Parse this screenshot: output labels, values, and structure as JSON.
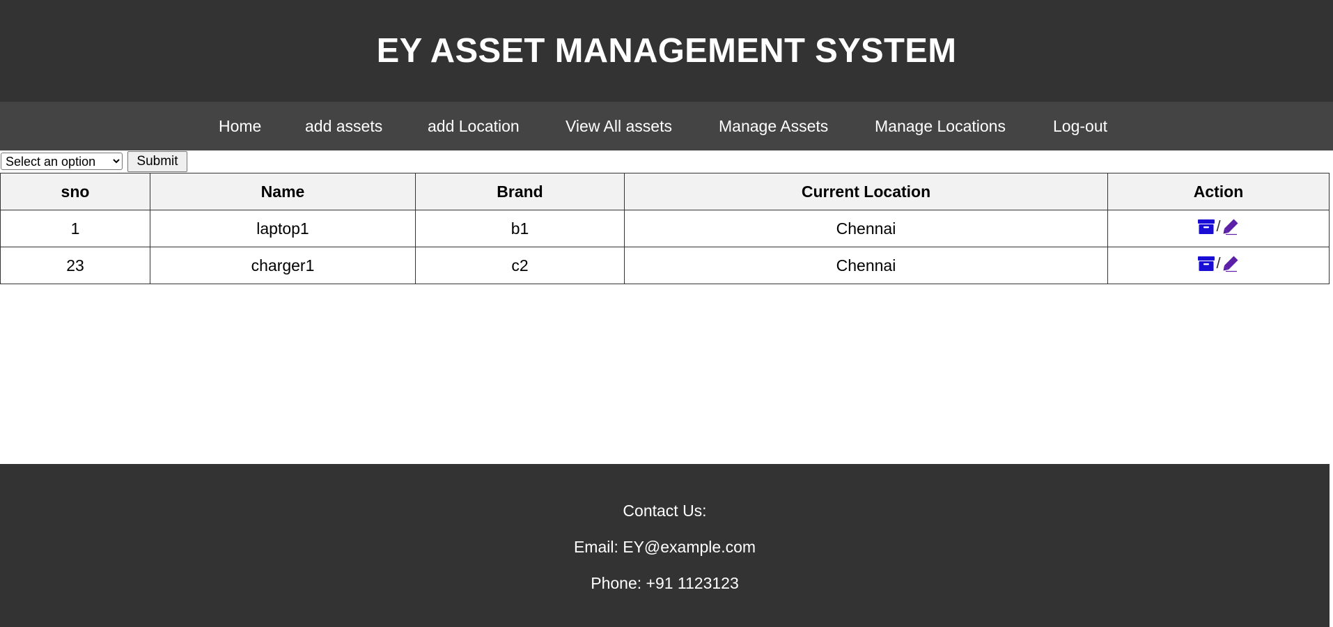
{
  "header": {
    "title": "EY ASSET MANAGEMENT SYSTEM"
  },
  "nav": {
    "items": [
      {
        "label": "Home"
      },
      {
        "label": "add assets"
      },
      {
        "label": "add Location"
      },
      {
        "label": "View All assets"
      },
      {
        "label": "Manage Assets"
      },
      {
        "label": "Manage Locations"
      },
      {
        "label": "Log-out"
      }
    ]
  },
  "filter": {
    "select_value": "Select an option",
    "submit_label": "Submit"
  },
  "table": {
    "headers": [
      "sno",
      "Name",
      "Brand",
      "Current Location",
      "Action"
    ],
    "rows": [
      {
        "sno": "1",
        "name": "laptop1",
        "brand": "b1",
        "location": "Chennai",
        "separator": "/"
      },
      {
        "sno": "23",
        "name": "charger1",
        "brand": "c2",
        "location": "Chennai",
        "separator": "/"
      }
    ],
    "action_icons": {
      "archive": "archive-icon",
      "edit": "pencil-icon",
      "archive_color": "#1a0dd6",
      "edit_color": "#5b1fa8"
    }
  },
  "footer": {
    "contact": "Contact Us:",
    "email": "Email: EY@example.com",
    "phone": "Phone: +91 1123123"
  },
  "colors": {
    "header_bg": "#333333",
    "nav_bg": "#444444",
    "footer_bg": "#333333",
    "table_header_bg": "#f2f2f2"
  }
}
